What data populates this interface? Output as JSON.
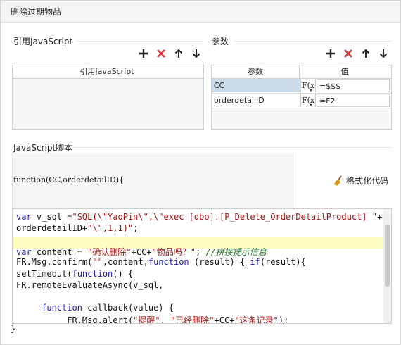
{
  "dialog": {
    "title": "删除过期物品"
  },
  "js_ref": {
    "section_label": "引用JavaScript",
    "column_header": "引用JavaScript",
    "rows": []
  },
  "params": {
    "section_label": "参数",
    "columns": [
      "参数",
      "值"
    ],
    "rows": [
      {
        "name": "CC",
        "fx": "F(x)",
        "value": "=$$$"
      },
      {
        "name": "orderdetailID",
        "fx": "F(x)",
        "value": "=F2"
      }
    ]
  },
  "script": {
    "section_label": "JavaScript脚本",
    "signature": "function(CC,orderdetailID){",
    "format_button": "格式化代码",
    "closing": "}",
    "lines": [
      [
        {
          "t": "var",
          "c": "kw"
        },
        {
          "t": " v_sql ="
        },
        {
          "t": "\"SQL(\\\"YaoPin\\\",\\\"exec [dbo].[P_Delete_OrderDetailProduct] \"",
          "c": "str"
        },
        {
          "t": "+"
        }
      ],
      [
        {
          "t": "orderdetailID+"
        },
        {
          "t": "\"\\\",1,1)\"",
          "c": "str"
        },
        {
          "t": ";"
        }
      ],
      [],
      [
        {
          "t": "var",
          "c": "kw"
        },
        {
          "t": " content = "
        },
        {
          "t": "\"确认删除\"",
          "c": "str"
        },
        {
          "t": "+CC+"
        },
        {
          "t": "\"物品吗？\"",
          "c": "str"
        },
        {
          "t": "; "
        },
        {
          "t": "//拼接提示信息",
          "c": "cmt"
        }
      ],
      [
        {
          "t": "FR.Msg.confirm("
        },
        {
          "t": "\"\"",
          "c": "str"
        },
        {
          "t": ",content,"
        },
        {
          "t": "function",
          "c": "kw"
        },
        {
          "t": " (result) { "
        },
        {
          "t": "if",
          "c": "kw"
        },
        {
          "t": "(result){"
        }
      ],
      [
        {
          "t": "setTimeout("
        },
        {
          "t": "function",
          "c": "kw"
        },
        {
          "t": "() {"
        }
      ],
      [
        {
          "t": "FR.remoteEvaluateAsync(v_sql,"
        }
      ],
      [],
      [
        {
          "t": "     "
        },
        {
          "t": "function",
          "c": "kw"
        },
        {
          "t": " callback(value) {"
        }
      ],
      [
        {
          "t": "          FR.Msg.alert("
        },
        {
          "t": "\"提醒\"",
          "c": "str"
        },
        {
          "t": ", "
        },
        {
          "t": "\"已经删除\"",
          "c": "str"
        },
        {
          "t": "+CC+"
        },
        {
          "t": "\"这条记录\"",
          "c": "str"
        },
        {
          "t": ");"
        }
      ]
    ]
  },
  "colors": {
    "accent_blue": "#1a1aa6",
    "string_red": "#a31515",
    "comment_green": "#2a7a2a",
    "highlight_line": "#ffffc4",
    "delete_red": "#e03030",
    "selected_cell": "#c9dbe9"
  }
}
